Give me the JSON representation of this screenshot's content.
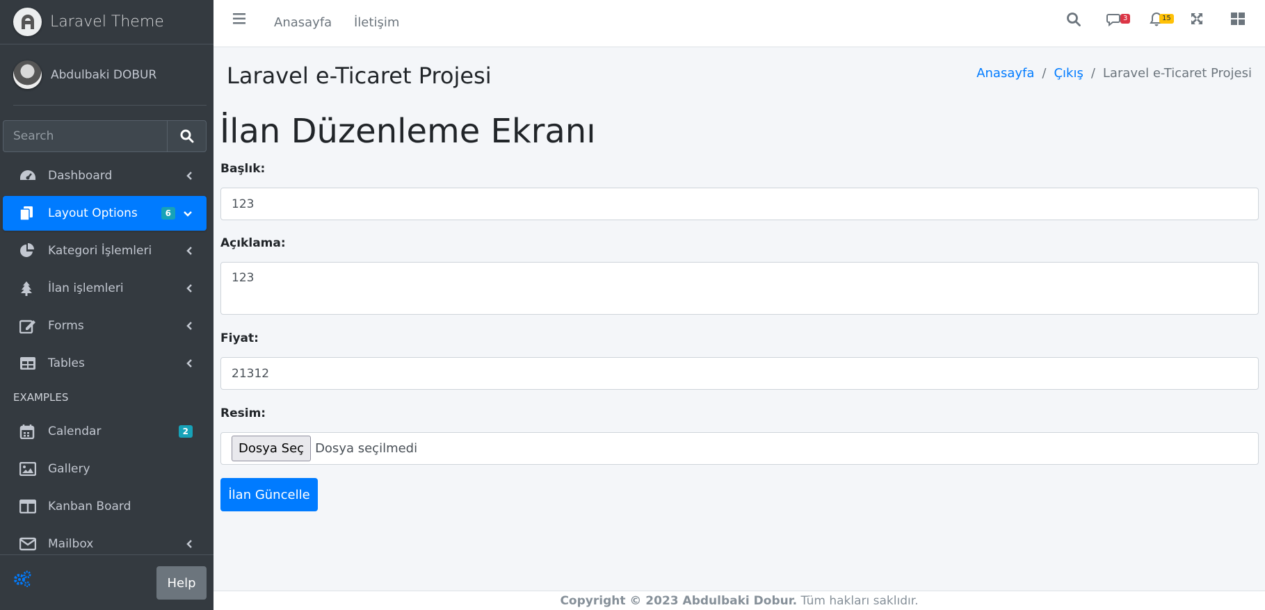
{
  "brand": {
    "name": "Laravel Theme"
  },
  "user": {
    "name": "Abdulbaki DOBUR"
  },
  "sidebar_search": {
    "placeholder": "Search"
  },
  "nav": {
    "dashboard": "Dashboard",
    "layout_options": "Layout Options",
    "layout_options_badge": "6",
    "kategori": "Kategori İşlemleri",
    "ilan": "İlan işlemleri",
    "forms": "Forms",
    "tables": "Tables",
    "examples_header": "EXAMPLES",
    "calendar": "Calendar",
    "calendar_badge": "2",
    "gallery": "Gallery",
    "kanban": "Kanban Board",
    "mailbox": "Mailbox"
  },
  "help_label": "Help",
  "topbar": {
    "link_home": "Anasayfa",
    "link_contact": "İletişim",
    "messages_count": "3",
    "notifications_count": "15"
  },
  "page": {
    "title": "Laravel e-Ticaret Projesi",
    "breadcrumb": [
      "Anasayfa",
      "Çıkış",
      "Laravel e-Ticaret Projesi"
    ],
    "breadcrumb_sep": "/",
    "heading": "İlan Düzenleme Ekranı"
  },
  "form": {
    "baslik_label": "Başlık:",
    "baslik_value": "123",
    "aciklama_label": "Açıklama:",
    "aciklama_value": "123",
    "fiyat_label": "Fiyat:",
    "fiyat_value": "21312",
    "resim_label": "Resim:",
    "file_button": "Dosya Seç",
    "file_status": "Dosya seçilmedi",
    "submit": "İlan Güncelle"
  },
  "footer": {
    "copyright": "Copyright © 2023 Abdulbaki Dobur.",
    "rights": "Tüm hakları saklıdır."
  },
  "colors": {
    "primary": "#007bff",
    "sidebar": "#343a40",
    "badge_info": "#17a2b8"
  }
}
